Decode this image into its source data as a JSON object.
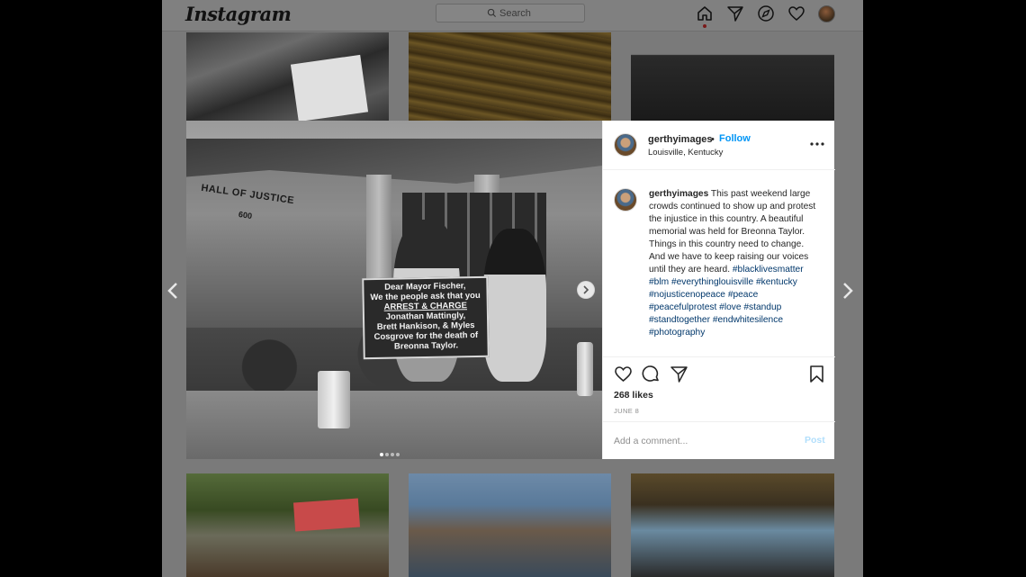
{
  "app": {
    "logo": "Instagram",
    "search_placeholder": "Search"
  },
  "nav": {
    "icons": [
      "home-icon",
      "direct-icon",
      "explore-icon",
      "activity-icon",
      "profile-avatar"
    ]
  },
  "post": {
    "username": "gerthyimages",
    "bullet": "•",
    "follow_label": "Follow",
    "location": "Louisville, Kentucky",
    "sign": {
      "line1": "Dear Mayor Fischer,",
      "line2": "We the people ask that you",
      "line3": "ARREST & CHARGE",
      "line4": "Jonathan Mattingly,",
      "line5": "Brett Hankison, & Myles",
      "line6": "Cosgrove for the death of",
      "line7": "Breonna Taylor."
    },
    "building_text": "HALL OF JUSTICE",
    "building_number": "600",
    "caption_text": "This past weekend large crowds continued to show up and protest the injustice in this country. A beautiful memorial was held for Breonna Taylor. Things in this country need to change. And we have to keep raising our voices until they are heard.",
    "hashtags": [
      "#blacklivesmatter",
      "#blm",
      "#everythinglouisville",
      "#kentucky",
      "#nojusticenopeace",
      "#peace",
      "#peacefulprotest",
      "#love",
      "#standup",
      "#standtogether",
      "#endwhitesilence",
      "#photography"
    ],
    "likes": "268 likes",
    "date": "JUNE 8",
    "comment_placeholder": "Add a comment...",
    "post_label": "Post"
  },
  "colors": {
    "link": "#0095f6",
    "hashtag": "#00376b",
    "post_disabled": "#b2dffc"
  }
}
